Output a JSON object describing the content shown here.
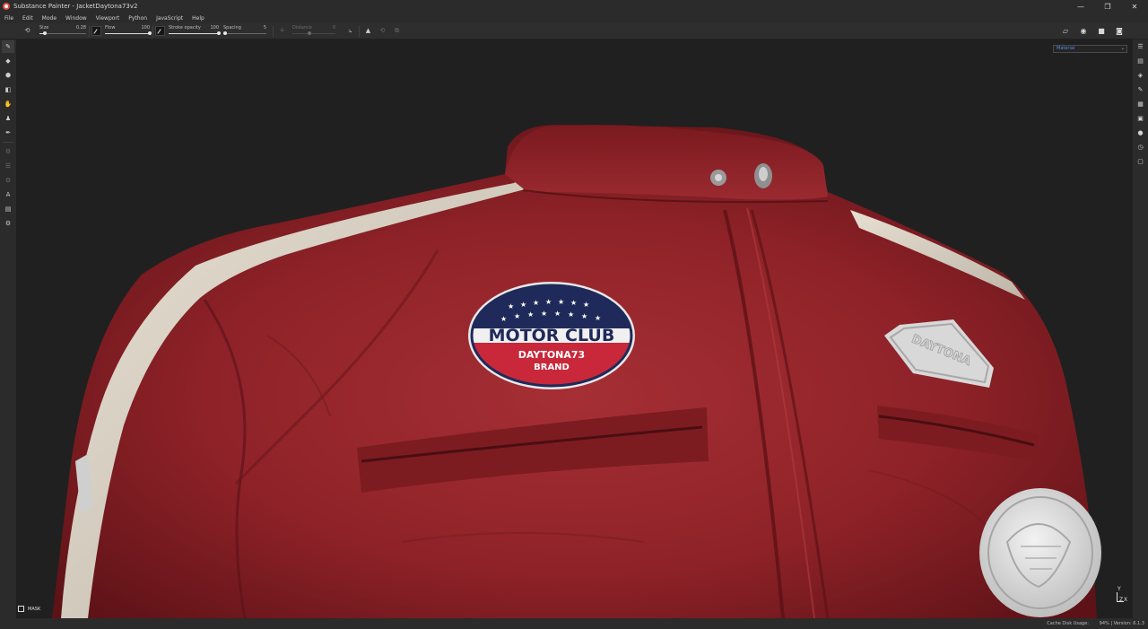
{
  "window": {
    "title": "Substance Painter - JacketDaytona73v2",
    "controls": {
      "minimize": "—",
      "maximize": "❐",
      "close": "✕"
    }
  },
  "menu": [
    "File",
    "Edit",
    "Mode",
    "Window",
    "Viewport",
    "Python",
    "JavaScript",
    "Help"
  ],
  "tool_options": {
    "size": {
      "label": "Size",
      "value": "0.28",
      "level": 0.12
    },
    "flow": {
      "label": "Flow",
      "value": "100",
      "level": 1.0
    },
    "stroke_opacity": {
      "label": "Stroke opacity",
      "value": "100",
      "level": 1.0
    },
    "spacing": {
      "label": "Spacing",
      "value": "5",
      "level": 0.05
    },
    "distance": {
      "label": "Distance",
      "value": "0",
      "level": 0.4,
      "enabled": false
    }
  },
  "viewport": {
    "channel_select": "Material",
    "mask_label": "MASK",
    "axis": {
      "y": "Y",
      "z": "Z",
      "x": "X"
    },
    "patch": {
      "line1": "MOTOR CLUB",
      "line2": "DAYTONA73",
      "line3": "BRAND"
    },
    "side_patch": "DAYTONA",
    "colors": {
      "leather": "#8e2228",
      "leather_dark": "#5c1216",
      "leather_light": "#b23a3f",
      "stripe": "#d9d2c4",
      "patch_blue": "#1f2a5a",
      "patch_red": "#c8283a"
    }
  },
  "left_tools": [
    "paint-brush",
    "eraser",
    "projection",
    "geometry-mask",
    "smudge",
    "clone",
    "color-picker",
    "polygon-fill",
    "bake",
    "layer",
    "material",
    "text",
    "document",
    "settings"
  ],
  "right_panels": [
    "texture-set-list",
    "texture-set-settings",
    "layers",
    "properties",
    "shelf",
    "display-settings",
    "shader-settings",
    "history",
    "log"
  ],
  "status": {
    "cache": "Cache Disk Usage:",
    "version": "94% | Version: 6.1.3"
  }
}
